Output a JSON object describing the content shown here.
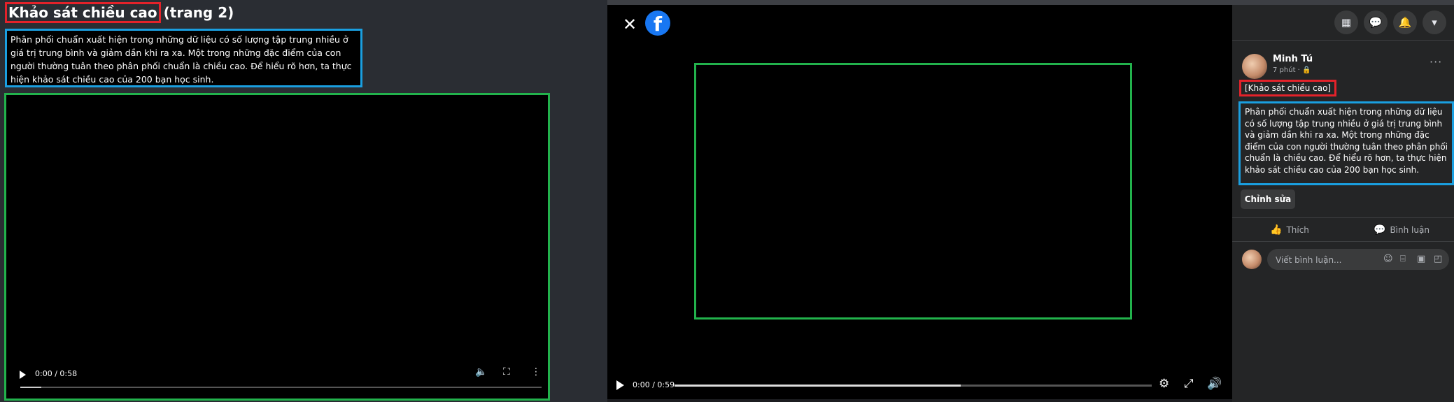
{
  "left_doc": {
    "title_highlight": "Khảo sát chiều cao",
    "title_rest": " (trang 2)",
    "description": "Phân phối chuẩn xuất hiện trong những dữ liệu có số lượng tập trung nhiều ở giá trị trung bình và giảm dần khi ra xa. Một trong những đặc điểm của con người thường tuân theo phân phối chuẩn là chiều cao. Để hiểu rõ hơn, ta thực hiện khảo sát chiều cao của 200 bạn học sinh.",
    "video": {
      "time": "0:00 / 0:58",
      "progress": 0.04
    }
  },
  "viewer": {
    "close_icon": "close-icon",
    "logo_letter": "f",
    "video": {
      "time": "0:00 / 0:59",
      "progress": 0.6
    }
  },
  "panel": {
    "author": "Minh Tú",
    "time": "7 phút · 🔒",
    "more": "···",
    "tag": "[Khảo sát chiều cao]",
    "description": "Phân phối chuẩn xuất hiện trong những dữ liệu có số lượng tập trung nhiều ở giá trị trung bình và giảm dần khi ra xa. Một trong những đặc điểm của con người thường tuân theo phân phối chuẩn là chiều cao. Để hiểu rõ hơn, ta thực hiện khảo sát chiều cao của 200 bạn học sinh.",
    "edit_label": "Chỉnh sửa",
    "like_label": "Thích",
    "comment_label": "Bình luận",
    "comment_placeholder": "Viết bình luận..."
  },
  "colors": {
    "red_box": "#e3222a",
    "blue_box": "#1a9fe0",
    "green_box": "#22b24c",
    "fb_blue": "#1877f2"
  }
}
